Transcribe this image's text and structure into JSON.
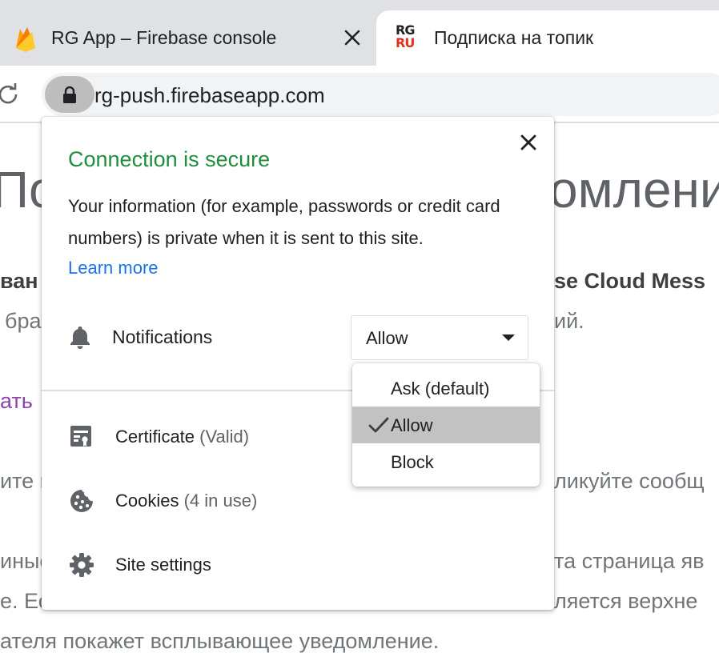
{
  "browser": {
    "tabs": [
      {
        "title": "RG App – Firebase console",
        "icon": "firebase-icon",
        "active": false
      },
      {
        "title": "Подписка на топик",
        "icon": "rg-ru-icon",
        "active": true
      }
    ],
    "url": "rg-push.firebaseapp.com"
  },
  "page_background": {
    "heading_left": "По",
    "heading_right": "омлени",
    "line1_left": "ван",
    "line1_right": "se Cloud Mess",
    "line2_left": "бра",
    "line2_right": "ий.",
    "link_left": "ать",
    "line3_left": "ите н",
    "line3_right": "ликуйте сообщ",
    "line4_left": "иные",
    "line4_right": "та страница яв",
    "line5_left": "е. Ес",
    "line5_right": "ляется верхне",
    "line6": "ателя покажет всплывающее уведомление."
  },
  "site_info": {
    "title": "Connection is secure",
    "description": "Your information (for example, passwords or credit card numbers) is private when it is sent to this site.",
    "learn_more": "Learn more",
    "notifications_label": "Notifications",
    "notifications_value": "Allow",
    "certificate_label": "Certificate",
    "certificate_status": "(Valid)",
    "cookies_label": "Cookies",
    "cookies_status": "(4 in use)",
    "site_settings_label": "Site settings"
  },
  "dropdown": {
    "options": [
      "Ask (default)",
      "Allow",
      "Block"
    ],
    "selected": "Allow"
  },
  "colors": {
    "secure_green": "#1e8e3e",
    "link_blue": "#1a73e8",
    "tabstrip_gray": "#dfe1e5",
    "selected_option": "#c2c2c2"
  }
}
